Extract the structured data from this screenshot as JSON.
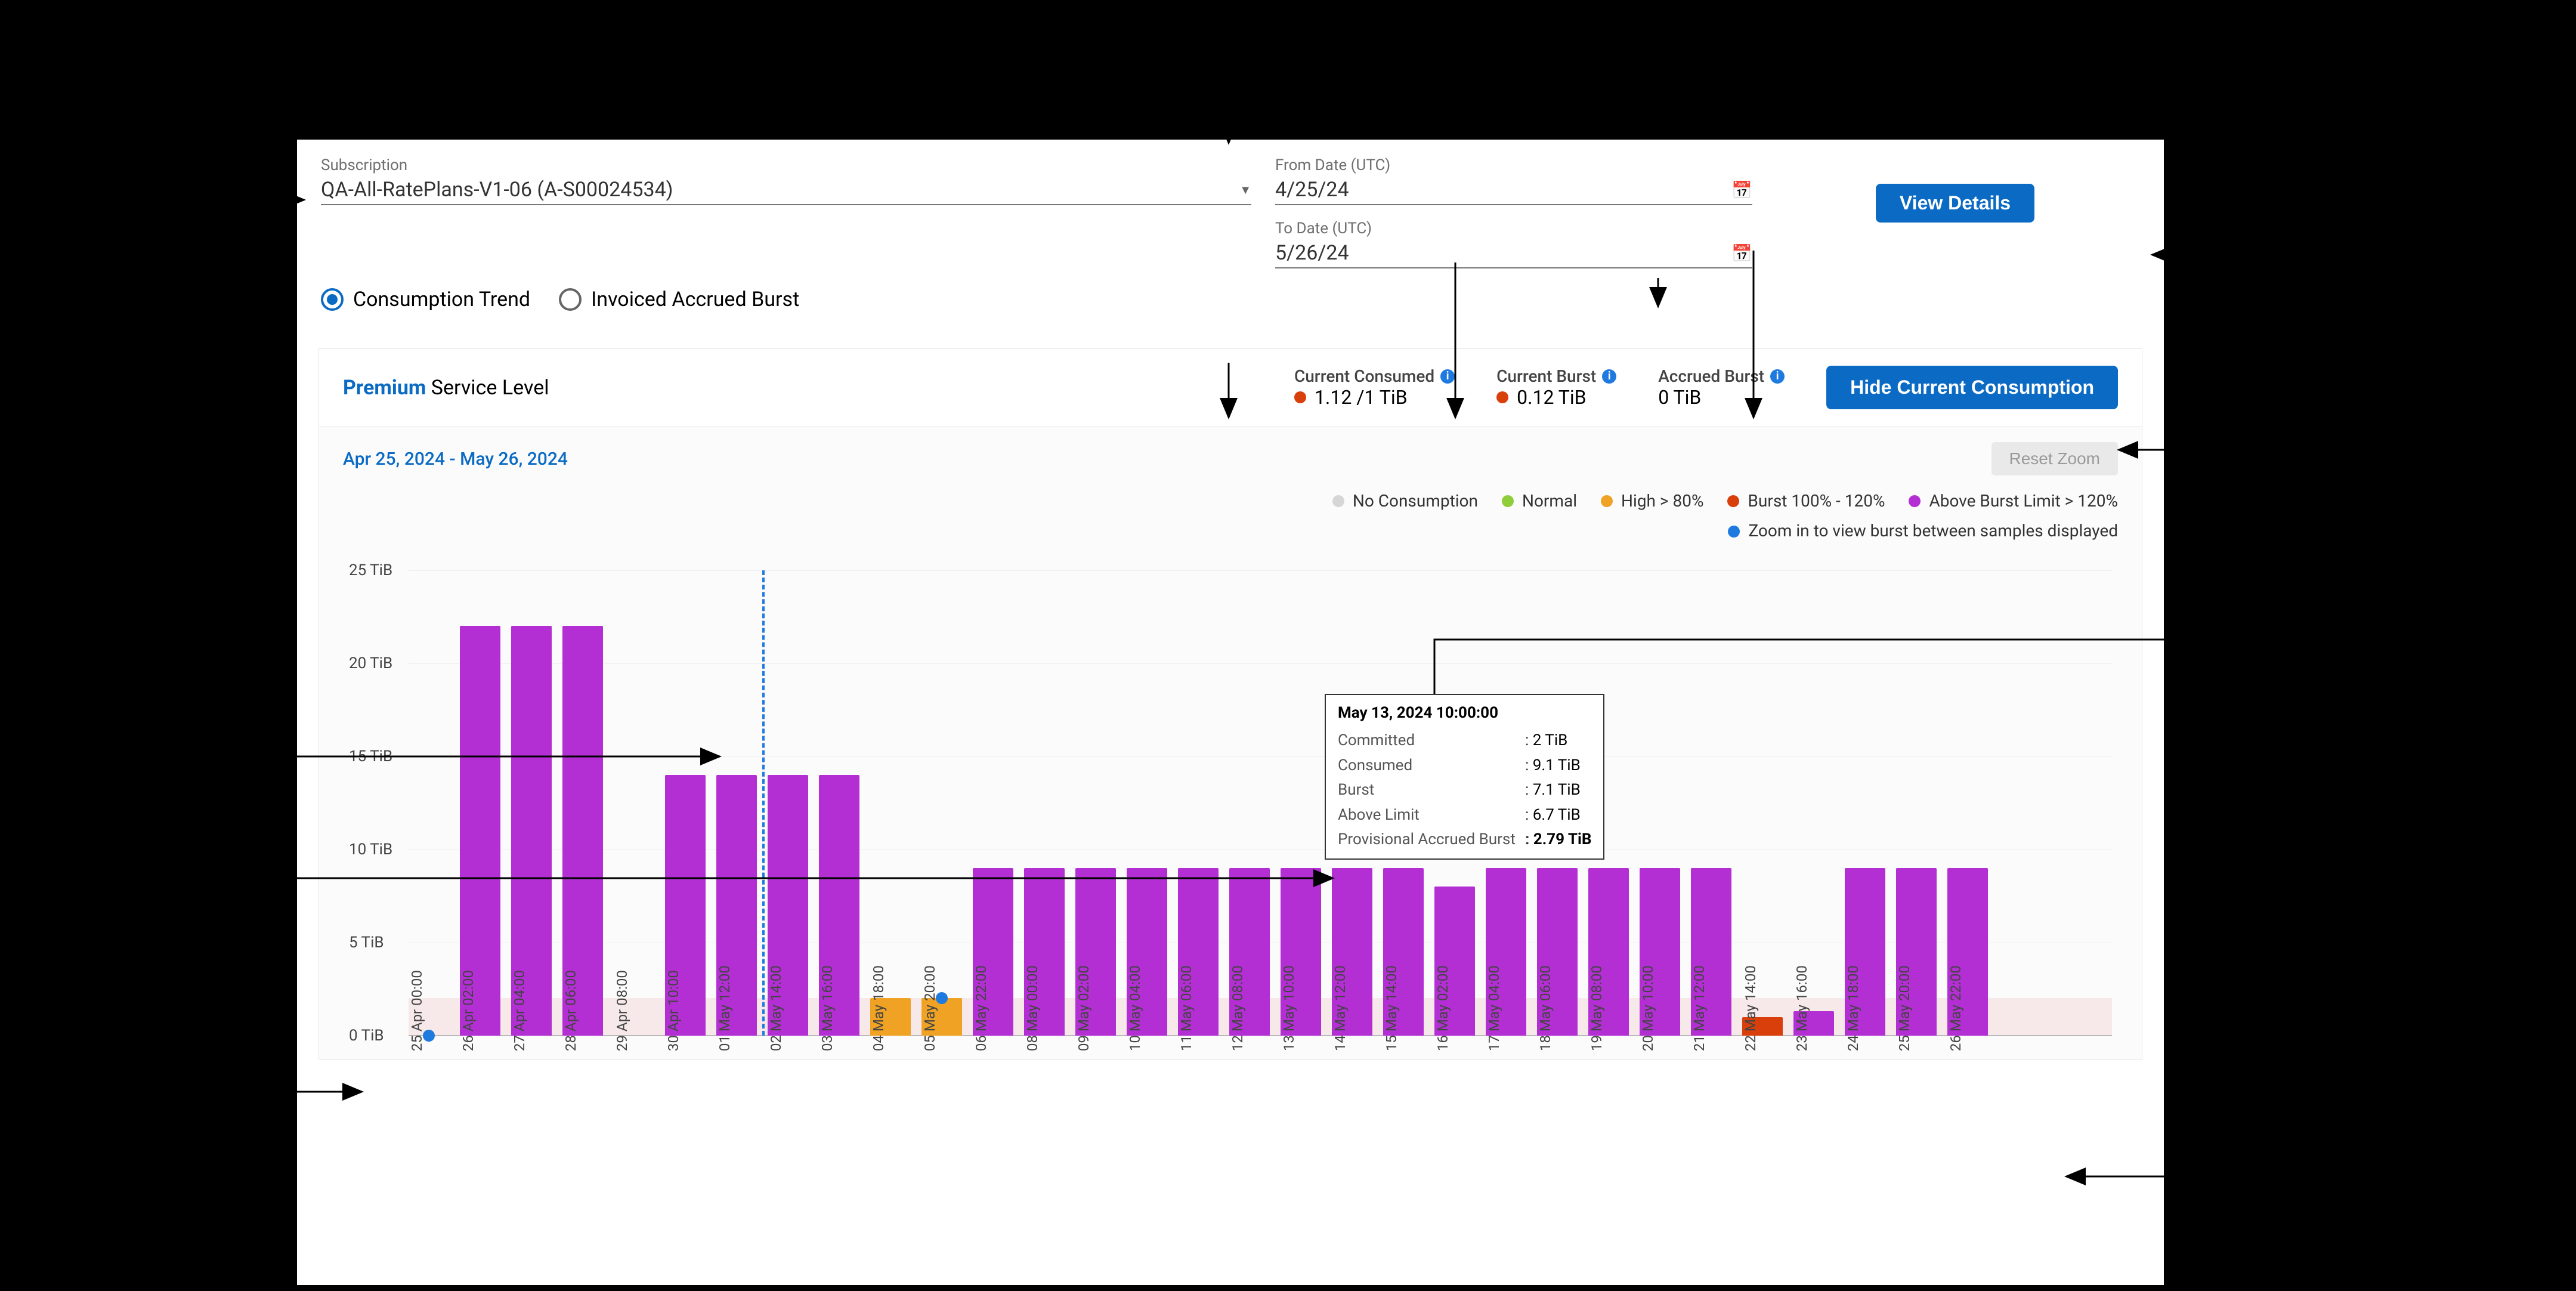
{
  "filters": {
    "subscription_label": "Subscription",
    "subscription_value": "QA-All-RatePlans-V1-06 (A-S00024534)",
    "from_label": "From Date (UTC)",
    "from_value": "4/25/24",
    "to_label": "To Date (UTC)",
    "to_value": "5/26/24",
    "view_details": "View Details"
  },
  "radios": {
    "consumption": "Consumption Trend",
    "invoiced": "Invoiced Accrued Burst"
  },
  "panel": {
    "premium": "Premium",
    "service_level_suffix": " Service Level",
    "consumed_lbl": "Current Consumed",
    "consumed_val": "1.12 /1 TiB",
    "burst_lbl": "Current Burst",
    "burst_val": "0.12 TiB",
    "accrued_lbl": "Accrued Burst",
    "accrued_val": "0 TiB",
    "hide_btn": "Hide Current Consumption",
    "range": "Apr 25, 2024 - May 26, 2024",
    "reset": "Reset Zoom"
  },
  "legend": {
    "no_consumption": "No Consumption",
    "normal": "Normal",
    "high": "High > 80%",
    "burst": "Burst 100% - 120%",
    "above": "Above Burst Limit > 120%",
    "zoom_hint": "Zoom in to view burst between samples displayed"
  },
  "tooltip": {
    "title": "May 13, 2024 10:00:00",
    "rows": [
      {
        "key": "Committed",
        "val": "2 TiB"
      },
      {
        "key": "Consumed",
        "val": "9.1 TiB"
      },
      {
        "key": "Burst",
        "val": "7.1 TiB"
      },
      {
        "key": "Above Limit",
        "val": "6.7 TiB"
      },
      {
        "key": "Provisional Accrued Burst",
        "val": "2.79 TiB"
      }
    ]
  },
  "chart_data": {
    "type": "bar",
    "ylabel": "TiB",
    "ylim": [
      0,
      25
    ],
    "y_ticks": [
      0,
      5,
      10,
      15,
      20,
      25
    ],
    "y_tick_labels": [
      "0 TiB",
      "5 TiB",
      "10 TiB",
      "15 TiB",
      "20 TiB",
      "25 TiB"
    ],
    "committed": 2,
    "dashed_marker_index": 7,
    "zoom_dots": [
      {
        "index": 0,
        "y": 0
      },
      {
        "index": 10,
        "y": 2
      }
    ],
    "colors": {
      "purple": "#b32fd4",
      "orange": "#f0a224",
      "darkorange": "#d93f0b"
    },
    "categories": [
      "25 Apr 00:00",
      "26 Apr 02:00",
      "27 Apr 04:00",
      "28 Apr 06:00",
      "29 Apr 08:00",
      "30 Apr 10:00",
      "01 May 12:00",
      "02 May 14:00",
      "03 May 16:00",
      "04 May 18:00",
      "05 May 20:00",
      "06 May 22:00",
      "08 May 00:00",
      "09 May 02:00",
      "10 May 04:00",
      "11 May 06:00",
      "12 May 08:00",
      "13 May 10:00",
      "14 May 12:00",
      "15 May 14:00",
      "16 May 02:00",
      "17 May 04:00",
      "18 May 06:00",
      "19 May 08:00",
      "20 May 10:00",
      "21 May 12:00",
      "22 May 14:00",
      "23 May 16:00",
      "24 May 18:00",
      "25 May 20:00",
      "26 May 22:00"
    ],
    "bars": [
      {
        "value": 0,
        "color": "purple"
      },
      {
        "value": 22,
        "color": "purple"
      },
      {
        "value": 22,
        "color": "purple"
      },
      {
        "value": 22,
        "color": "purple"
      },
      {
        "value": 0,
        "color": "purple"
      },
      {
        "value": 14,
        "color": "purple"
      },
      {
        "value": 14,
        "color": "purple"
      },
      {
        "value": 14,
        "color": "purple"
      },
      {
        "value": 14,
        "color": "purple"
      },
      {
        "value": 2,
        "color": "orange"
      },
      {
        "value": 2,
        "color": "orange"
      },
      {
        "value": 9,
        "color": "purple"
      },
      {
        "value": 9,
        "color": "purple"
      },
      {
        "value": 9,
        "color": "purple"
      },
      {
        "value": 9,
        "color": "purple"
      },
      {
        "value": 9,
        "color": "purple"
      },
      {
        "value": 9,
        "color": "purple"
      },
      {
        "value": 9,
        "color": "purple"
      },
      {
        "value": 9,
        "color": "purple"
      },
      {
        "value": 9,
        "color": "purple"
      },
      {
        "value": 8,
        "color": "purple"
      },
      {
        "value": 9,
        "color": "purple"
      },
      {
        "value": 9,
        "color": "purple"
      },
      {
        "value": 9,
        "color": "purple"
      },
      {
        "value": 9,
        "color": "purple"
      },
      {
        "value": 9,
        "color": "purple"
      },
      {
        "value": 1,
        "color": "darkorange"
      },
      {
        "value": 1.3,
        "color": "purple"
      },
      {
        "value": 9,
        "color": "purple"
      },
      {
        "value": 9,
        "color": "purple"
      },
      {
        "value": 9,
        "color": "purple"
      }
    ]
  }
}
